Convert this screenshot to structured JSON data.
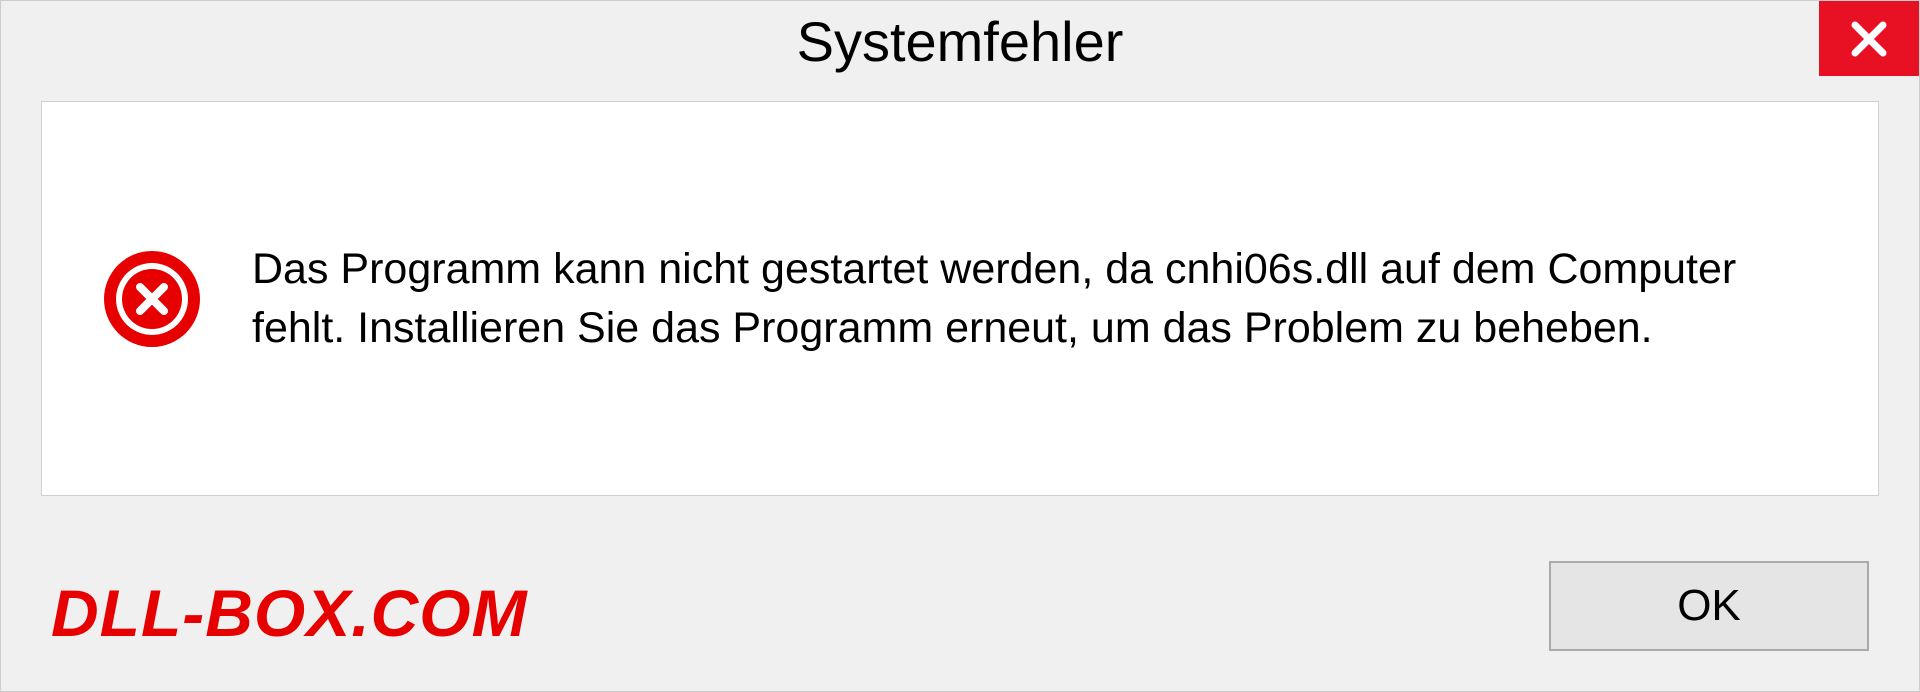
{
  "dialog": {
    "title": "Systemfehler",
    "message": "Das Programm kann nicht gestartet werden, da cnhi06s.dll auf dem Computer fehlt. Installieren Sie das Programm erneut, um das Problem zu beheben.",
    "ok_label": "OK"
  },
  "watermark": "DLL-BOX.COM"
}
